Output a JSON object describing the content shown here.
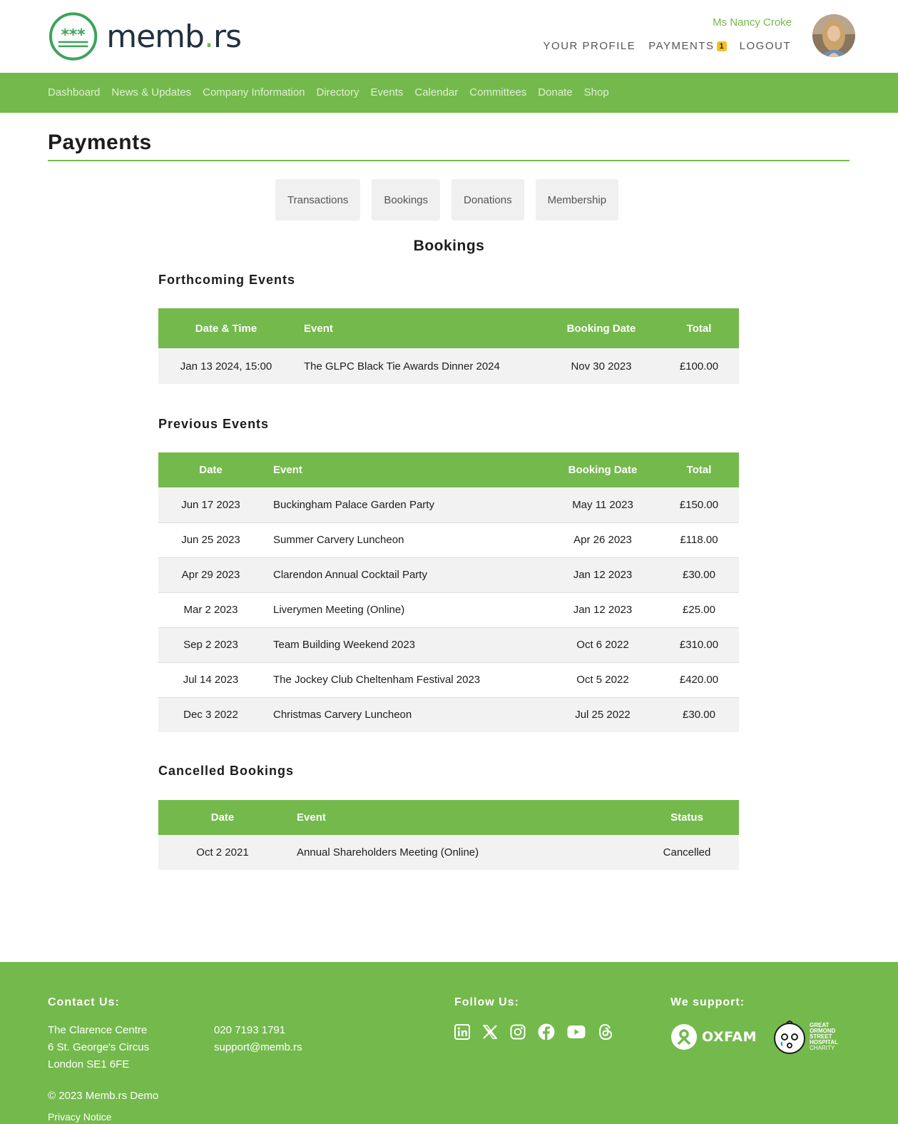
{
  "brand": {
    "name_left": "memb",
    "name_dot": ".",
    "name_right": "rs",
    "logo_stars": "***"
  },
  "user": {
    "name": "Ms Nancy Croke"
  },
  "top_links": {
    "profile": "YOUR PROFILE",
    "payments": "PAYMENTS",
    "payments_badge": "1",
    "logout": "LOGOUT"
  },
  "nav": [
    "Dashboard",
    "News & Updates",
    "Company Information",
    "Directory",
    "Events",
    "Calendar",
    "Committees",
    "Donate",
    "Shop"
  ],
  "page": {
    "title": "Payments",
    "section": "Bookings"
  },
  "tabs": [
    "Transactions",
    "Bookings",
    "Donations",
    "Membership"
  ],
  "forthcoming": {
    "title": "Forthcoming Events",
    "headers": [
      "Date & Time",
      "Event",
      "Booking Date",
      "Total"
    ],
    "rows": [
      [
        "Jan 13 2024, 15:00",
        "The GLPC Black Tie Awards Dinner 2024",
        "Nov 30 2023",
        "£100.00"
      ]
    ]
  },
  "previous": {
    "title": "Previous Events",
    "headers": [
      "Date",
      "Event",
      "Booking Date",
      "Total"
    ],
    "rows": [
      [
        "Jun 17 2023",
        "Buckingham Palace Garden Party",
        "May 11 2023",
        "£150.00"
      ],
      [
        "Jun 25 2023",
        "Summer Carvery Luncheon",
        "Apr 26 2023",
        "£118.00"
      ],
      [
        "Apr 29 2023",
        "Clarendon Annual Cocktail Party",
        "Jan 12 2023",
        "£30.00"
      ],
      [
        "Mar 2 2023",
        "Liverymen Meeting (Online)",
        "Jan 12 2023",
        "£25.00"
      ],
      [
        "Sep 2 2023",
        "Team Building Weekend 2023",
        "Oct 6 2022",
        "£310.00"
      ],
      [
        "Jul 14 2023",
        "The Jockey Club Cheltenham Festival 2023",
        "Oct 5 2022",
        "£420.00"
      ],
      [
        "Dec 3 2022",
        "Christmas Carvery Luncheon",
        "Jul 25 2022",
        "£30.00"
      ]
    ]
  },
  "cancelled": {
    "title": "Cancelled Bookings",
    "headers": [
      "Date",
      "Event",
      "Status"
    ],
    "rows": [
      [
        "Oct 2 2021",
        "Annual Shareholders Meeting (Online)",
        "Cancelled"
      ]
    ]
  },
  "footer": {
    "contact_title": "Contact Us:",
    "address": [
      "The Clarence Centre",
      "6 St. George's Circus",
      "London SE1 6FE"
    ],
    "phone": "020 7193 1791",
    "email": "support@memb.rs",
    "copyright": "© 2023 Memb.rs Demo",
    "privacy": "Privacy Notice",
    "follow_title": "Follow Us:",
    "social_icons": [
      "linkedin-icon",
      "x-icon",
      "instagram-icon",
      "facebook-icon",
      "youtube-icon",
      "threads-icon"
    ],
    "support_title": "We support:",
    "charity_1": "OXFAM",
    "charity_2_lines": [
      "GREAT",
      "ORMOND",
      "STREET",
      "HOSPITAL",
      "CHARITY"
    ]
  },
  "colors": {
    "brand_green": "#74b94c",
    "badge_yellow": "#f4c01e",
    "logo_navy": "#22313f"
  }
}
